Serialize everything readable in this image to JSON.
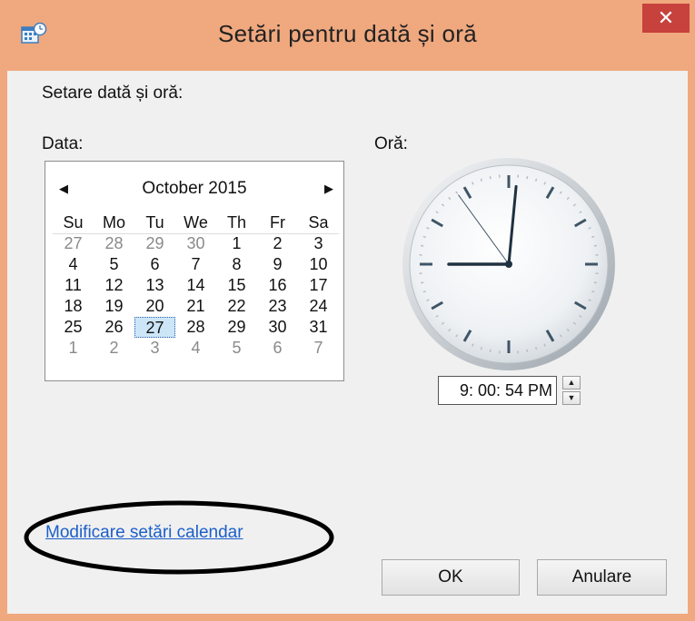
{
  "window": {
    "title": "Setări pentru dată și oră",
    "close_symbol": "✕",
    "app_icon": "calendar-clock-icon",
    "frame_color": "#f0a87e",
    "close_color": "#c7413d"
  },
  "content": {
    "heading": "Setare dată și oră:",
    "date_label": "Data:",
    "time_label": "Oră:"
  },
  "calendar": {
    "prev_symbol": "◀",
    "next_symbol": "▶",
    "month_year": "October 2015",
    "weekdays": [
      "Su",
      "Mo",
      "Tu",
      "We",
      "Th",
      "Fr",
      "Sa"
    ],
    "days": [
      [
        "27",
        "28",
        "29",
        "30",
        "1",
        "2",
        "3"
      ],
      [
        "4",
        "5",
        "6",
        "7",
        "8",
        "9",
        "10"
      ],
      [
        "11",
        "12",
        "13",
        "14",
        "15",
        "16",
        "17"
      ],
      [
        "18",
        "19",
        "20",
        "21",
        "22",
        "23",
        "24"
      ],
      [
        "25",
        "26",
        "27",
        "28",
        "29",
        "30",
        "31"
      ],
      [
        "1",
        "2",
        "3",
        "4",
        "5",
        "6",
        "7"
      ]
    ],
    "selected": "27",
    "selected_color": "#cde6f7"
  },
  "clock": {
    "hours": 9,
    "minutes": 0,
    "seconds": 54
  },
  "time_field": {
    "value": "9: 00: 54 PM",
    "up_symbol": "▲",
    "down_symbol": "▼"
  },
  "link": {
    "label": "Modificare setări calendar",
    "color": "#1b5fc9"
  },
  "buttons": {
    "ok": "OK",
    "cancel": "Anulare"
  }
}
